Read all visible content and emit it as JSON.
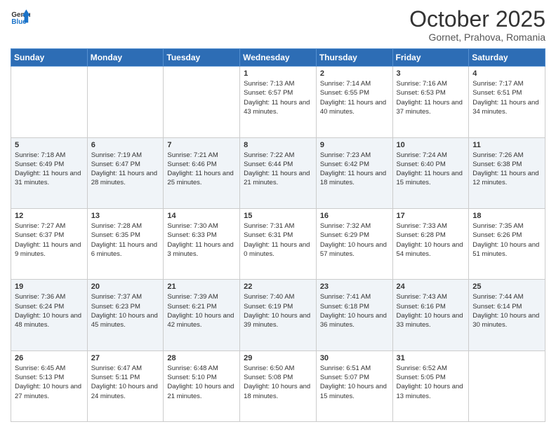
{
  "header": {
    "logo_line1": "General",
    "logo_line2": "Blue",
    "title": "October 2025",
    "subtitle": "Gornet, Prahova, Romania"
  },
  "weekdays": [
    "Sunday",
    "Monday",
    "Tuesday",
    "Wednesday",
    "Thursday",
    "Friday",
    "Saturday"
  ],
  "weeks": [
    [
      {
        "day": "",
        "info": ""
      },
      {
        "day": "",
        "info": ""
      },
      {
        "day": "",
        "info": ""
      },
      {
        "day": "1",
        "info": "Sunrise: 7:13 AM\nSunset: 6:57 PM\nDaylight: 11 hours and 43 minutes."
      },
      {
        "day": "2",
        "info": "Sunrise: 7:14 AM\nSunset: 6:55 PM\nDaylight: 11 hours and 40 minutes."
      },
      {
        "day": "3",
        "info": "Sunrise: 7:16 AM\nSunset: 6:53 PM\nDaylight: 11 hours and 37 minutes."
      },
      {
        "day": "4",
        "info": "Sunrise: 7:17 AM\nSunset: 6:51 PM\nDaylight: 11 hours and 34 minutes."
      }
    ],
    [
      {
        "day": "5",
        "info": "Sunrise: 7:18 AM\nSunset: 6:49 PM\nDaylight: 11 hours and 31 minutes."
      },
      {
        "day": "6",
        "info": "Sunrise: 7:19 AM\nSunset: 6:47 PM\nDaylight: 11 hours and 28 minutes."
      },
      {
        "day": "7",
        "info": "Sunrise: 7:21 AM\nSunset: 6:46 PM\nDaylight: 11 hours and 25 minutes."
      },
      {
        "day": "8",
        "info": "Sunrise: 7:22 AM\nSunset: 6:44 PM\nDaylight: 11 hours and 21 minutes."
      },
      {
        "day": "9",
        "info": "Sunrise: 7:23 AM\nSunset: 6:42 PM\nDaylight: 11 hours and 18 minutes."
      },
      {
        "day": "10",
        "info": "Sunrise: 7:24 AM\nSunset: 6:40 PM\nDaylight: 11 hours and 15 minutes."
      },
      {
        "day": "11",
        "info": "Sunrise: 7:26 AM\nSunset: 6:38 PM\nDaylight: 11 hours and 12 minutes."
      }
    ],
    [
      {
        "day": "12",
        "info": "Sunrise: 7:27 AM\nSunset: 6:37 PM\nDaylight: 11 hours and 9 minutes."
      },
      {
        "day": "13",
        "info": "Sunrise: 7:28 AM\nSunset: 6:35 PM\nDaylight: 11 hours and 6 minutes."
      },
      {
        "day": "14",
        "info": "Sunrise: 7:30 AM\nSunset: 6:33 PM\nDaylight: 11 hours and 3 minutes."
      },
      {
        "day": "15",
        "info": "Sunrise: 7:31 AM\nSunset: 6:31 PM\nDaylight: 11 hours and 0 minutes."
      },
      {
        "day": "16",
        "info": "Sunrise: 7:32 AM\nSunset: 6:29 PM\nDaylight: 10 hours and 57 minutes."
      },
      {
        "day": "17",
        "info": "Sunrise: 7:33 AM\nSunset: 6:28 PM\nDaylight: 10 hours and 54 minutes."
      },
      {
        "day": "18",
        "info": "Sunrise: 7:35 AM\nSunset: 6:26 PM\nDaylight: 10 hours and 51 minutes."
      }
    ],
    [
      {
        "day": "19",
        "info": "Sunrise: 7:36 AM\nSunset: 6:24 PM\nDaylight: 10 hours and 48 minutes."
      },
      {
        "day": "20",
        "info": "Sunrise: 7:37 AM\nSunset: 6:23 PM\nDaylight: 10 hours and 45 minutes."
      },
      {
        "day": "21",
        "info": "Sunrise: 7:39 AM\nSunset: 6:21 PM\nDaylight: 10 hours and 42 minutes."
      },
      {
        "day": "22",
        "info": "Sunrise: 7:40 AM\nSunset: 6:19 PM\nDaylight: 10 hours and 39 minutes."
      },
      {
        "day": "23",
        "info": "Sunrise: 7:41 AM\nSunset: 6:18 PM\nDaylight: 10 hours and 36 minutes."
      },
      {
        "day": "24",
        "info": "Sunrise: 7:43 AM\nSunset: 6:16 PM\nDaylight: 10 hours and 33 minutes."
      },
      {
        "day": "25",
        "info": "Sunrise: 7:44 AM\nSunset: 6:14 PM\nDaylight: 10 hours and 30 minutes."
      }
    ],
    [
      {
        "day": "26",
        "info": "Sunrise: 6:45 AM\nSunset: 5:13 PM\nDaylight: 10 hours and 27 minutes."
      },
      {
        "day": "27",
        "info": "Sunrise: 6:47 AM\nSunset: 5:11 PM\nDaylight: 10 hours and 24 minutes."
      },
      {
        "day": "28",
        "info": "Sunrise: 6:48 AM\nSunset: 5:10 PM\nDaylight: 10 hours and 21 minutes."
      },
      {
        "day": "29",
        "info": "Sunrise: 6:50 AM\nSunset: 5:08 PM\nDaylight: 10 hours and 18 minutes."
      },
      {
        "day": "30",
        "info": "Sunrise: 6:51 AM\nSunset: 5:07 PM\nDaylight: 10 hours and 15 minutes."
      },
      {
        "day": "31",
        "info": "Sunrise: 6:52 AM\nSunset: 5:05 PM\nDaylight: 10 hours and 13 minutes."
      },
      {
        "day": "",
        "info": ""
      }
    ]
  ]
}
